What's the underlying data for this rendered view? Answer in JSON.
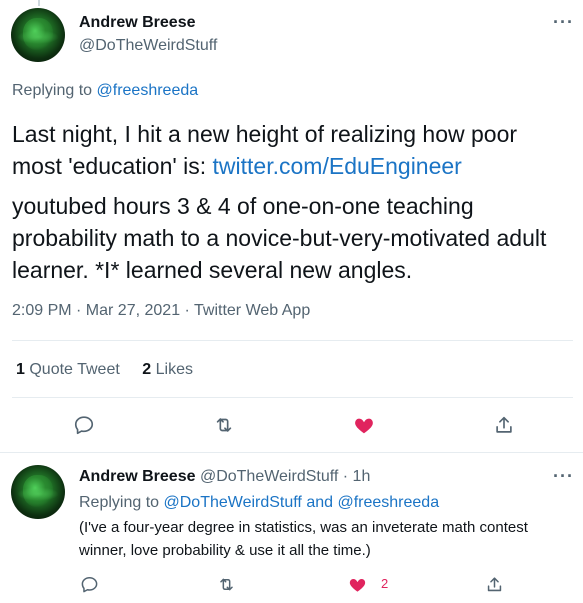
{
  "main_tweet": {
    "author_name": "Andrew Breese",
    "author_handle": "@DoTheWeirdStuff",
    "more_label": "···",
    "replying_prefix": "Replying to",
    "replying_to": "@freeshreeda",
    "text_part1": "Last night, I hit a new height of realizing how poor most 'education' is: ",
    "text_link": "twitter.com/EduEngineer",
    "text_part2": "youtubed hours 3 & 4 of one-on-one teaching probability math to a novice-but-very-motivated adult learner. *I* learned several new angles.",
    "meta": "2:09 PM · Mar 27, 2021 · Twitter Web App",
    "quote_count": "1",
    "quote_label": "Quote Tweet",
    "like_count": "2",
    "like_label": "Likes",
    "actions": [
      "reply-icon",
      "retweet-icon",
      "heart-filled-icon",
      "share-icon"
    ]
  },
  "reply_tweet": {
    "author_name": "Andrew Breese",
    "author_handle": "@DoTheWeirdStuff",
    "time": "· 1h",
    "more_label": "···",
    "replying_prefix": "Replying to",
    "replying_to": "@DoTheWeirdStuff and @freeshreeda",
    "text": "(I've a four-year degree in statistics, was an inveterate math contest winner, love probability & use it all the time.)",
    "like_count": "2",
    "actions": [
      "reply-icon",
      "retweet-icon",
      "heart-filled-icon",
      "share-icon"
    ]
  },
  "colors": {
    "link": "#1b74c5",
    "secondary_text": "#536471",
    "like_active": "#e0245e",
    "divider": "#e6ecf0"
  }
}
